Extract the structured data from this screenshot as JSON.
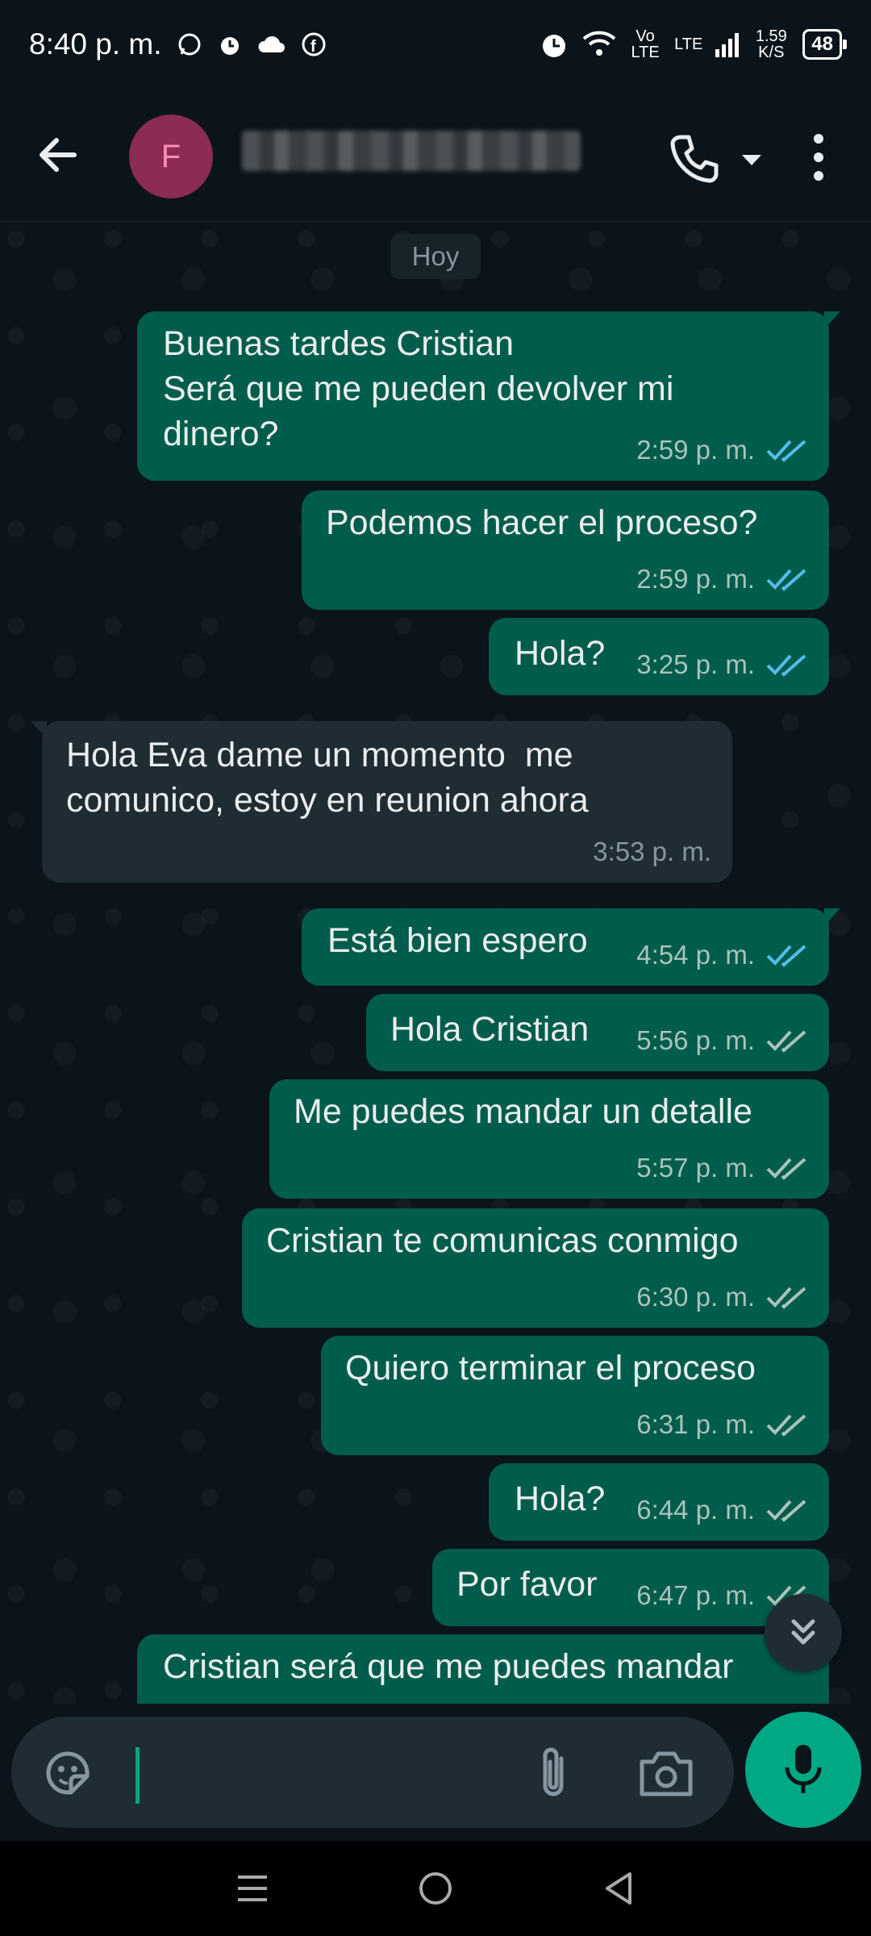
{
  "status_bar": {
    "time": "8:40 p. m.",
    "network": "Vo LTE",
    "lte": "LTE",
    "speed": "1.59 K/S",
    "battery": "48"
  },
  "header": {
    "avatar_letter": "F",
    "contact_name": ""
  },
  "chat": {
    "date_chip": "Hoy",
    "messages": [
      {
        "dir": "out",
        "text": "Buenas tardes Cristian\nSerá que me pueden devolver mi\ndinero?",
        "time": "2:59 p. m.",
        "status": "read"
      },
      {
        "dir": "out",
        "text": "Podemos hacer el proceso?",
        "time": "2:59 p. m.",
        "status": "read"
      },
      {
        "dir": "out",
        "text": "Hola?",
        "time": "3:25 p. m.",
        "status": "read"
      },
      {
        "dir": "in",
        "text": "Hola Eva dame un momento  me\ncomunico, estoy en reunion ahora",
        "time": "3:53 p. m."
      },
      {
        "dir": "out",
        "text": "Está bien espero",
        "time": "4:54 p. m.",
        "status": "read"
      },
      {
        "dir": "out",
        "text": "Hola Cristian",
        "time": "5:56 p. m.",
        "status": "delivered"
      },
      {
        "dir": "out",
        "text": "Me puedes mandar un detalle",
        "time": "5:57 p. m.",
        "status": "delivered"
      },
      {
        "dir": "out",
        "text": "Cristian te comunicas conmigo",
        "time": "6:30 p. m.",
        "status": "delivered"
      },
      {
        "dir": "out",
        "text": "Quiero terminar el proceso",
        "time": "6:31 p. m.",
        "status": "delivered"
      },
      {
        "dir": "out",
        "text": "Hola?",
        "time": "6:44 p. m.",
        "status": "delivered"
      },
      {
        "dir": "out",
        "text": "Por favor",
        "time": "6:47 p. m.",
        "status": "delivered"
      },
      {
        "dir": "out",
        "text": "Cristian será que me puedes mandar",
        "time": "",
        "status": ""
      }
    ]
  },
  "composer": {
    "text": ""
  },
  "colors": {
    "outgoing_bubble": "#005c4b",
    "incoming_bubble": "#202c33",
    "accent": "#00a884",
    "read_tick": "#53bdeb",
    "delivered_tick": "#aac3bd"
  }
}
